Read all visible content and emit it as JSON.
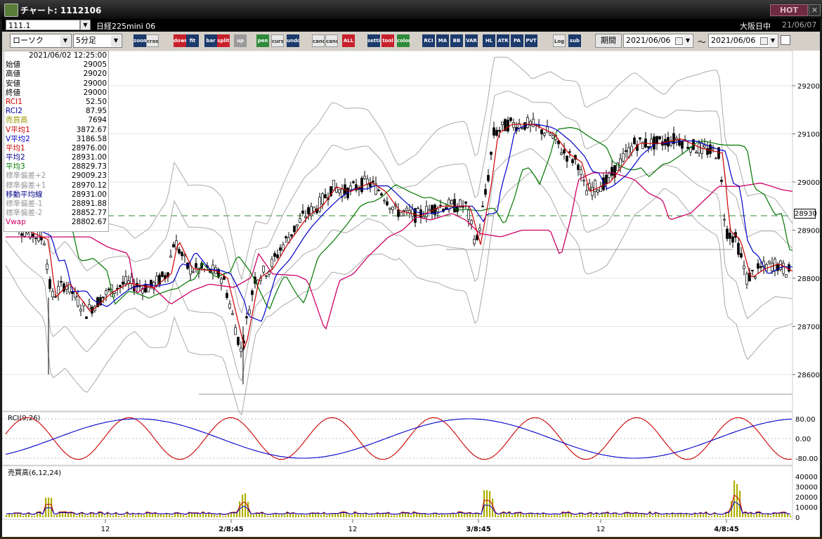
{
  "window": {
    "title": "チャート: 1112106",
    "hot_label": "HOT",
    "close_label": "✕"
  },
  "header": {
    "symbol_code": "111.1",
    "symbol_name": "日経225mini 06",
    "market": "大阪日中",
    "date": "21/06/07"
  },
  "toolbar": {
    "chart_type": "ローソク",
    "interval": "5分足",
    "buttons": [
      "zoom",
      "crosshair",
      "down",
      "fit",
      "bar",
      "split",
      "up",
      "pen",
      "cursor",
      "undo",
      "candle-a",
      "candle-b",
      "ALL",
      "settings",
      "tool",
      "color",
      "RCI",
      "MA",
      "BB",
      "VAR",
      "HL",
      "ATR",
      "PA",
      "PVT",
      "Log",
      "sub"
    ],
    "period_label": "期間",
    "from_date": "2021/06/06",
    "to_date": "2021/06/06",
    "tilde": "～"
  },
  "data_panel": {
    "timestamp": "2021/06/02  12:25:00",
    "rows": [
      {
        "label": "始値",
        "value": "29005",
        "color": "#000000"
      },
      {
        "label": "高値",
        "value": "29020",
        "color": "#000000"
      },
      {
        "label": "安値",
        "value": "29000",
        "color": "#000000"
      },
      {
        "label": "終値",
        "value": "29000",
        "color": "#000000"
      },
      {
        "label": "RCI1",
        "value": "52.50",
        "color": "#cc0000"
      },
      {
        "label": "RCI2",
        "value": "87.95",
        "color": "#0000aa"
      },
      {
        "label": "売買高",
        "value": "7694",
        "color": "#999900"
      },
      {
        "label": "V平均1",
        "value": "3872.67",
        "color": "#cc0000"
      },
      {
        "label": "V平均2",
        "value": "3186.58",
        "color": "#0000cc"
      },
      {
        "label": "平均1",
        "value": "28976.00",
        "color": "#cc0000"
      },
      {
        "label": "平均2",
        "value": "28931.00",
        "color": "#000088"
      },
      {
        "label": "平均3",
        "value": "28829.73",
        "color": "#007700"
      },
      {
        "label": "標準偏差+2",
        "value": "29009.23",
        "color": "#999999"
      },
      {
        "label": "標準偏差+1",
        "value": "28970.12",
        "color": "#999999"
      },
      {
        "label": "移動平均線",
        "value": "28931.00",
        "color": "#000088"
      },
      {
        "label": "標準偏差-1",
        "value": "28891.88",
        "color": "#999999"
      },
      {
        "label": "標準偏差-2",
        "value": "28852.77",
        "color": "#999999"
      },
      {
        "label": "Vwap",
        "value": "28802.67",
        "color": "#cc0066"
      }
    ]
  },
  "price_axis": {
    "ticks": [
      "29200",
      "29100",
      "29000",
      "28900",
      "28800",
      "28700",
      "28600"
    ],
    "current_price": "28930"
  },
  "rci_panel": {
    "label": "RCI(9,26)",
    "ticks": [
      "80.00",
      "0.00",
      "-80.00"
    ]
  },
  "volume_panel": {
    "label": "売買高(6,12,24)",
    "ticks": [
      "40000",
      "30000",
      "20000",
      "10000",
      "0"
    ]
  },
  "time_axis": {
    "labels": [
      "12",
      "2/8:45",
      "12",
      "3/8:45",
      "12",
      "4/8:45"
    ]
  },
  "colors": {
    "ma1": "#cc0000",
    "ma2": "#0000cc",
    "ma3": "#007700",
    "vwap": "#cc0066",
    "bands": "#aaaaaa",
    "volume": "#b0b000"
  }
}
